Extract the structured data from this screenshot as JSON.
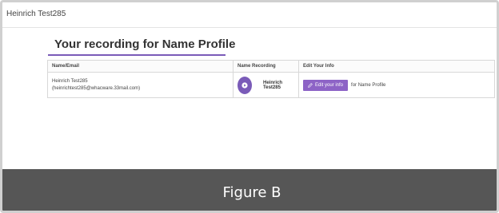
{
  "header": {
    "user_name": "Heinrich Test285"
  },
  "section": {
    "title": "Your recording for Name Profile"
  },
  "table": {
    "columns": [
      "Name/Email",
      "Name Recording",
      "Edit Your Info"
    ],
    "row": {
      "name": "Heinrich Test285",
      "email": "(heinrichtest285@whacware.33mail.com)",
      "recording_name": "Heinrich Test285",
      "edit_label": "Edit your info",
      "for_text": "for Name Profile"
    }
  },
  "caption": "Figure B",
  "icons": {
    "heading": "microphone-icon",
    "play": "play-icon",
    "edit": "pencil-icon"
  },
  "colors": {
    "accent": "#7a5bb8",
    "button": "#8d63c6",
    "caption_band": "#565656"
  }
}
